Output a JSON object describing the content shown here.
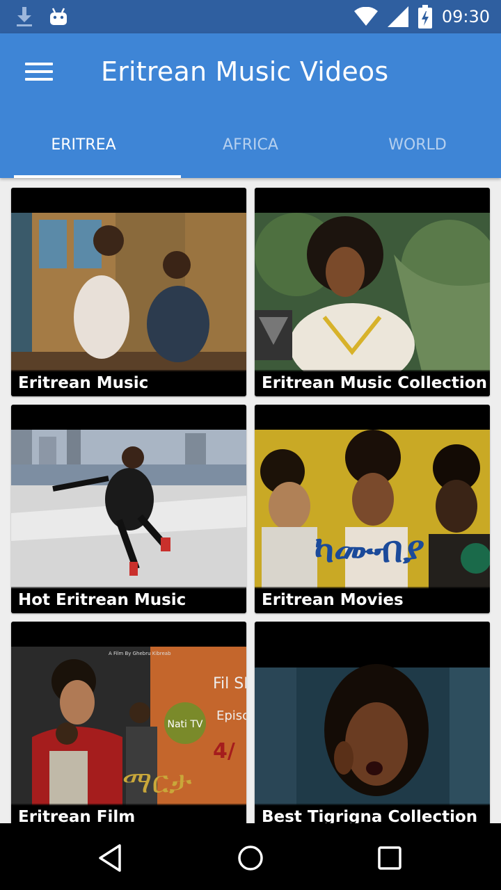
{
  "status_bar": {
    "time": "09:30",
    "icons": [
      "download-icon",
      "android-icon",
      "wifi-icon",
      "signal-icon",
      "battery-icon"
    ]
  },
  "app_bar": {
    "title": "Eritrean Music Videos",
    "menu_icon": "hamburger-menu-icon"
  },
  "tabs": [
    {
      "label": "ERITREA",
      "active": true
    },
    {
      "label": "AFRICA",
      "active": false
    },
    {
      "label": "WORLD",
      "active": false
    }
  ],
  "cards": [
    {
      "label": "Eritrean Music"
    },
    {
      "label": "Eritrean Music Collection"
    },
    {
      "label": "Hot Eritrean Music"
    },
    {
      "label": "Eritrean Movies",
      "thumb_text": "ካሙብያ"
    },
    {
      "label": "Eritrean Film",
      "thumb_text": "ማርታ",
      "thumb_caption": "A Film By Ghebru Kibreab",
      "thumb_badge": "Nati TV",
      "thumb_series": "Fil SERIES",
      "thumb_episode": "Episo",
      "thumb_number": "4/"
    },
    {
      "label": "Best Tigrigna Collection"
    }
  ],
  "nav_bar": {
    "icons": [
      "back-icon",
      "home-icon",
      "recents-icon"
    ]
  },
  "colors": {
    "status_bar": "#2f5fa0",
    "app_bar": "#3e85d6",
    "background": "#eeeeee"
  }
}
